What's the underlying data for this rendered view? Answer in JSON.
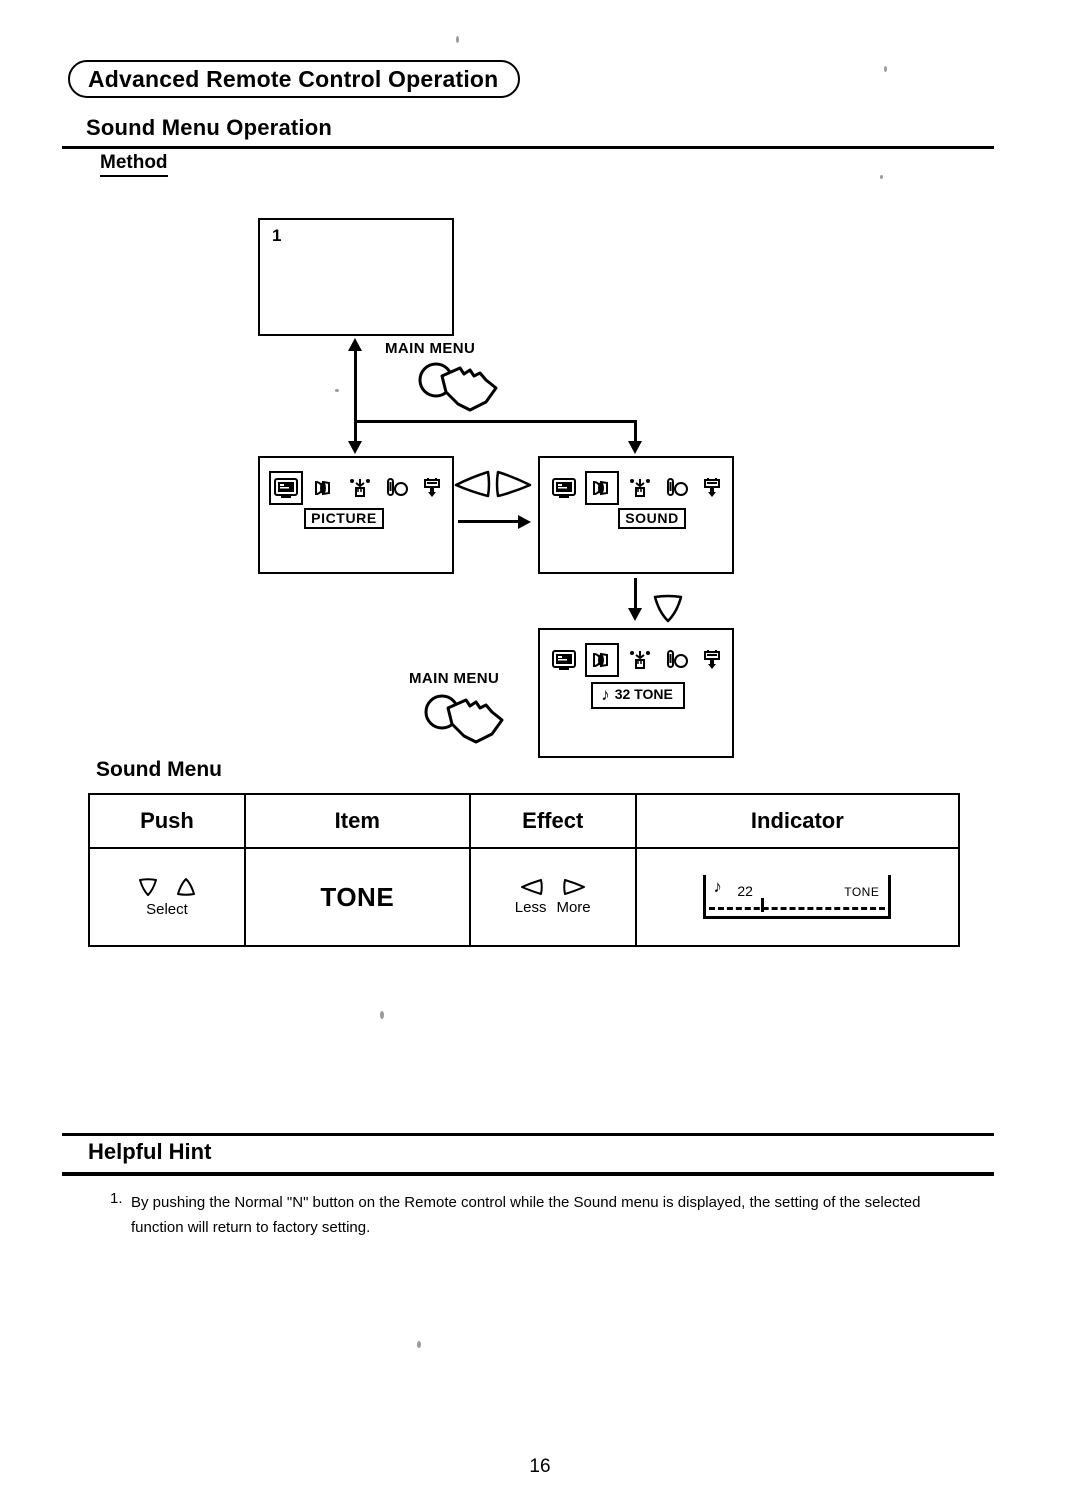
{
  "header": {
    "chapter_title": "Advanced Remote Control Operation",
    "section_title": "Sound Menu Operation",
    "sub_section_title": "Method"
  },
  "diagram": {
    "step1_index": "1",
    "main_menu_label_top": "MAIN MENU",
    "main_menu_label_bottom": "MAIN MENU",
    "picture_label": "PICTURE",
    "sound_label": "SOUND",
    "tone_value_note": "♪",
    "tone_value_text": "32 TONE",
    "icons": [
      "tv-picture-icon",
      "speaker-sound-icon",
      "hand-setup-icon",
      "timer-clock-icon",
      "plug-input-icon"
    ]
  },
  "menu_table": {
    "title": "Sound Menu",
    "columns": [
      "Push",
      "Item",
      "Effect",
      "Indicator"
    ],
    "rows": [
      {
        "push_sub_label": "Select",
        "item": "TONE",
        "effect_left_label": "Less",
        "effect_right_label": "More",
        "indicator_note": "♪",
        "indicator_value": "22",
        "indicator_name": "TONE"
      }
    ]
  },
  "helpful_hint": {
    "title": "Helpful Hint",
    "item_number": "1.",
    "item_text": "By pushing the Normal \"N\" button on the Remote control while the Sound menu is displayed, the setting of the selected function will return to factory setting."
  },
  "footer": {
    "page_number": "16"
  }
}
